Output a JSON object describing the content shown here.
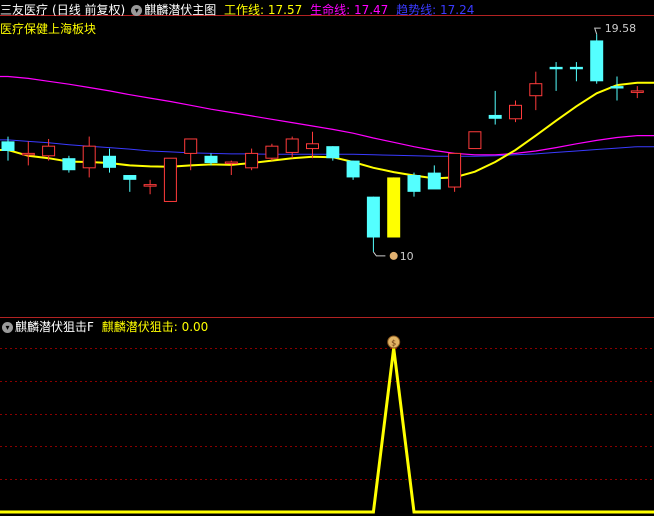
{
  "header": {
    "stock_name": "三友医疗",
    "period_label": "(日线 前复权)",
    "indicator_name": "麒麟潜伏主图",
    "work_line_label": "工作线: 17.57",
    "life_line_label": "生命线: 17.47",
    "trend_line_label": "趋势线: 17.24",
    "sector_label": "医疗保健上海板块"
  },
  "sub_header": {
    "indicator_name": "麒麟潜伏狙击F",
    "value_label": "麒麟潜伏狙击: 0.00"
  },
  "colors": {
    "background": "#000000",
    "up_candle": "#ff3b3b",
    "down_candle": "#54ffff",
    "signal_candle": "#ffff00",
    "work_line": "#ffff00",
    "life_line": "#ff00ff",
    "trend_line": "#3a3aff",
    "grid": "#8b0000"
  },
  "icons": {
    "collapse": "chevron-down-icon",
    "signal": "money-bag-icon"
  },
  "chart_data": [
    {
      "type": "candlestick",
      "title": "麒麟潜伏主图",
      "ylim": [
        13.8,
        20.0
      ],
      "annotations": {
        "high_label": "19.58",
        "low_label": "10"
      },
      "candles": [
        {
          "o": 17.35,
          "h": 17.45,
          "l": 16.95,
          "c": 17.15
        },
        {
          "o": 17.1,
          "h": 17.35,
          "l": 16.85,
          "c": 17.1
        },
        {
          "o": 17.05,
          "h": 17.4,
          "l": 16.95,
          "c": 17.25
        },
        {
          "o": 17.0,
          "h": 17.05,
          "l": 16.7,
          "c": 16.75
        },
        {
          "o": 16.8,
          "h": 17.45,
          "l": 16.6,
          "c": 17.25
        },
        {
          "o": 17.05,
          "h": 17.2,
          "l": 16.7,
          "c": 16.8
        },
        {
          "o": 16.65,
          "h": 16.65,
          "l": 16.3,
          "c": 16.55
        },
        {
          "o": 16.45,
          "h": 16.55,
          "l": 16.25,
          "c": 16.45
        },
        {
          "o": 16.1,
          "h": 17.0,
          "l": 16.1,
          "c": 17.0
        },
        {
          "o": 17.1,
          "h": 17.4,
          "l": 16.75,
          "c": 17.4
        },
        {
          "o": 17.05,
          "h": 17.1,
          "l": 16.85,
          "c": 16.9
        },
        {
          "o": 16.9,
          "h": 16.95,
          "l": 16.65,
          "c": 16.92
        },
        {
          "o": 16.8,
          "h": 17.2,
          "l": 16.75,
          "c": 17.1
        },
        {
          "o": 17.0,
          "h": 17.3,
          "l": 16.95,
          "c": 17.25
        },
        {
          "o": 17.12,
          "h": 17.45,
          "l": 17.0,
          "c": 17.4
        },
        {
          "o": 17.2,
          "h": 17.55,
          "l": 17.0,
          "c": 17.3
        },
        {
          "o": 17.25,
          "h": 17.25,
          "l": 16.95,
          "c": 17.0
        },
        {
          "o": 16.95,
          "h": 16.95,
          "l": 16.55,
          "c": 16.6
        },
        {
          "o": 16.2,
          "h": 16.2,
          "l": 15.05,
          "c": 15.35
        },
        {
          "o": 15.35,
          "h": 16.6,
          "l": 15.35,
          "c": 16.6
        },
        {
          "o": 16.65,
          "h": 16.7,
          "l": 16.2,
          "c": 16.3
        },
        {
          "o": 16.7,
          "h": 16.85,
          "l": 16.4,
          "c": 16.35
        },
        {
          "o": 16.4,
          "h": 17.1,
          "l": 16.3,
          "c": 17.1
        },
        {
          "o": 17.2,
          "h": 17.55,
          "l": 17.2,
          "c": 17.55
        },
        {
          "o": 17.9,
          "h": 18.4,
          "l": 17.7,
          "c": 17.82
        },
        {
          "o": 17.82,
          "h": 18.2,
          "l": 17.75,
          "c": 18.1
        },
        {
          "o": 18.3,
          "h": 18.8,
          "l": 18.0,
          "c": 18.55
        },
        {
          "o": 18.9,
          "h": 19.0,
          "l": 18.4,
          "c": 18.85
        },
        {
          "o": 18.9,
          "h": 19.0,
          "l": 18.6,
          "c": 18.85
        },
        {
          "o": 19.45,
          "h": 19.58,
          "l": 18.55,
          "c": 18.6
        },
        {
          "o": 18.5,
          "h": 18.7,
          "l": 18.2,
          "c": 18.45
        },
        {
          "o": 18.4,
          "h": 18.5,
          "l": 18.25,
          "c": 18.4
        }
      ],
      "signal_index": 19,
      "work_line": [
        17.17,
        17.05,
        17.0,
        16.93,
        16.92,
        16.9,
        16.85,
        16.83,
        16.82,
        16.85,
        16.87,
        16.86,
        16.9,
        16.95,
        17.0,
        17.03,
        17.02,
        16.92,
        16.8,
        16.71,
        16.64,
        16.58,
        16.6,
        16.72,
        16.92,
        17.17,
        17.47,
        17.78,
        18.08,
        18.35,
        18.52,
        18.57
      ],
      "life_line": [
        18.7,
        18.66,
        18.6,
        18.54,
        18.47,
        18.4,
        18.32,
        18.25,
        18.18,
        18.1,
        18.02,
        17.95,
        17.88,
        17.81,
        17.74,
        17.67,
        17.6,
        17.52,
        17.42,
        17.33,
        17.24,
        17.16,
        17.1,
        17.07,
        17.07,
        17.1,
        17.15,
        17.22,
        17.3,
        17.37,
        17.43,
        17.47
      ],
      "trend_line": [
        17.38,
        17.35,
        17.32,
        17.28,
        17.25,
        17.22,
        17.19,
        17.15,
        17.13,
        17.11,
        17.1,
        17.09,
        17.09,
        17.08,
        17.08,
        17.08,
        17.08,
        17.08,
        17.07,
        17.06,
        17.05,
        17.04,
        17.04,
        17.04,
        17.05,
        17.07,
        17.09,
        17.12,
        17.15,
        17.18,
        17.21,
        17.24
      ]
    },
    {
      "type": "line",
      "title": "麒麟潜伏狙击F",
      "series": [
        {
          "name": "麒麟潜伏狙击",
          "values": [
            0,
            0,
            0,
            0,
            0,
            0,
            0,
            0,
            0,
            0,
            0,
            0,
            0,
            0,
            0,
            0,
            0,
            0,
            0,
            1,
            0,
            0,
            0,
            0,
            0,
            0,
            0,
            0,
            0,
            0,
            0,
            0
          ]
        }
      ],
      "ylim": [
        0,
        1
      ]
    }
  ]
}
